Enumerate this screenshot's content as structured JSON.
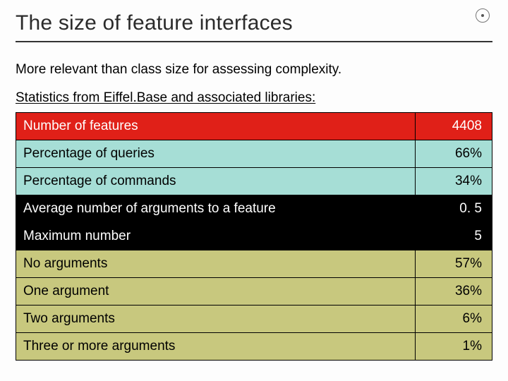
{
  "title": "The size of feature interfaces",
  "intro": "More relevant than class size for assessing complexity.",
  "stats_source": "Statistics from Eiffel.Base and associated libraries:",
  "rows": [
    {
      "label": "Number of features",
      "value": "4408"
    },
    {
      "label": "Percentage of queries",
      "value": "66%"
    },
    {
      "label": "Percentage of commands",
      "value": "34%"
    },
    {
      "label": "Average number of arguments to a feature",
      "value": "0. 5"
    },
    {
      "label": "Maximum number",
      "value": "5"
    },
    {
      "label": "No arguments",
      "value": "57%"
    },
    {
      "label": "One argument",
      "value": "36%"
    },
    {
      "label": "Two arguments",
      "value": "6%"
    },
    {
      "label": "Three or more arguments",
      "value": "1%"
    }
  ],
  "chart_data": {
    "type": "table",
    "title": "The size of feature interfaces",
    "rows": [
      [
        "Number of features",
        4408
      ],
      [
        "Percentage of queries",
        "66%"
      ],
      [
        "Percentage of commands",
        "34%"
      ],
      [
        "Average number of arguments to a feature",
        0.5
      ],
      [
        "Maximum number",
        5
      ],
      [
        "No arguments",
        "57%"
      ],
      [
        "One argument",
        "36%"
      ],
      [
        "Two arguments",
        "6%"
      ],
      [
        "Three or more arguments",
        "1%"
      ]
    ]
  }
}
